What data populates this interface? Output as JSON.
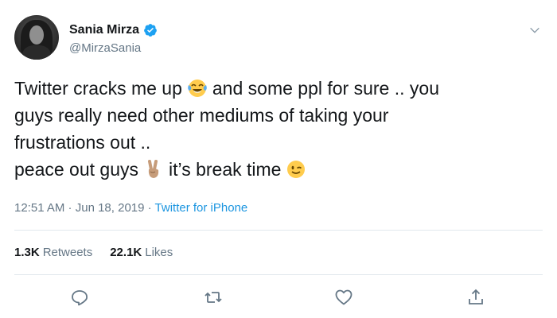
{
  "user": {
    "display_name": "Sania Mirza",
    "handle": "@MirzaSania",
    "verified": true
  },
  "tweet": {
    "line1_a": "Twitter cracks me up",
    "line1_b": "and some ppl for sure .. you",
    "line2": "guys really need other mediums of taking your",
    "line3": "frustrations out ..",
    "line4_a": "peace out guys",
    "line4_b": "it’s break time",
    "emojis": [
      "tears-of-joy-icon",
      "victory-hand-icon",
      "winking-face-icon"
    ]
  },
  "meta": {
    "time": "12:51 AM",
    "separator1": " · ",
    "date": "Jun 18, 2019",
    "separator2": " · ",
    "source": "Twitter for iPhone"
  },
  "stats": {
    "retweets_count": "1.3K",
    "retweets_label": "Retweets",
    "likes_count": "22.1K",
    "likes_label": "Likes"
  },
  "colors": {
    "accent": "#1da1f2",
    "link": "#1b95e0",
    "text": "#14171a",
    "muted": "#657786"
  },
  "actions": [
    "reply-icon",
    "retweet-icon",
    "like-icon",
    "share-icon"
  ]
}
